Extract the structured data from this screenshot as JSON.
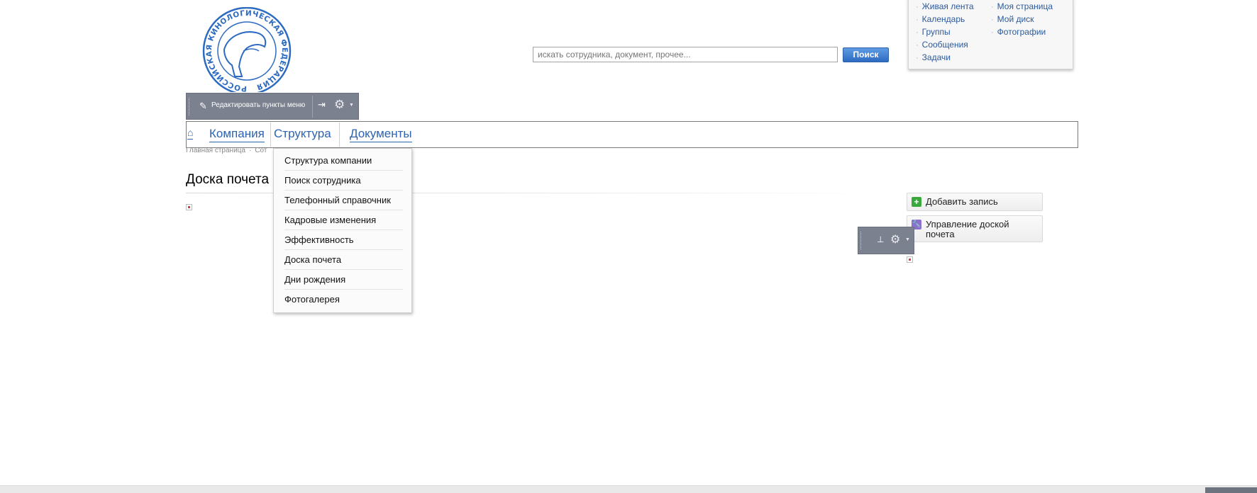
{
  "logo": {
    "text": "РОССИЙСКАЯ КИНОЛОГИЧЕСКАЯ ФЕДЕРАЦИЯ"
  },
  "search": {
    "placeholder": "искать сотрудника, документ, прочее...",
    "button_label": "Поиск"
  },
  "quick_links": {
    "column1": [
      "Живая лента",
      "Календарь",
      "Группы",
      "Сообщения",
      "Задачи"
    ],
    "column2": [
      "Моя страница",
      "Мой диск",
      "Фотографии"
    ]
  },
  "edit_toolbar": {
    "label": "Редактировать пункты меню"
  },
  "nav": {
    "items": [
      "Компания",
      "Структура",
      "Документы"
    ]
  },
  "breadcrumb": {
    "items": [
      "Главная страница",
      "Сот"
    ]
  },
  "page": {
    "title": "Доска почета"
  },
  "dropdown": {
    "items": [
      "Структура компании",
      "Поиск сотрудника",
      "Телефонный справочник",
      "Кадровые изменения",
      "Эффективность",
      "Доска почета",
      "Дни рождения",
      "Фотогалерея"
    ]
  },
  "actions": {
    "add_label": "Добавить запись",
    "manage_label": "Управление доской почета"
  },
  "colors": {
    "link": "#2d63b0",
    "toolbar": "#7c8190",
    "search_button": "#3b78cf",
    "add_icon": "#3aa83a",
    "manage_icon": "#8c6fd1"
  }
}
